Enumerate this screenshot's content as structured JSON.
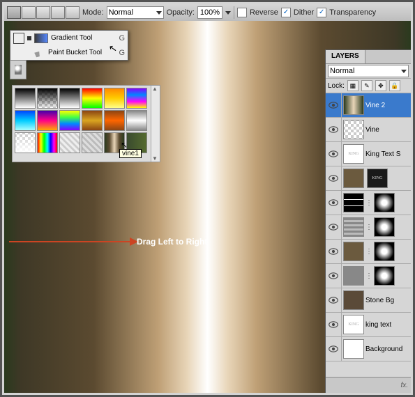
{
  "optbar": {
    "mode_label": "Mode:",
    "mode_value": "Normal",
    "opacity_label": "Opacity:",
    "opacity_value": "100%",
    "reverse_label": "Reverse",
    "dither_label": "Dither",
    "transparency_label": "Transparency",
    "reverse_checked": false,
    "dither_checked": true,
    "transparency_checked": true
  },
  "flyout": {
    "items": [
      {
        "label": "Gradient Tool",
        "shortcut": "G"
      },
      {
        "label": "Paint Bucket Tool",
        "shortcut": "G"
      }
    ]
  },
  "picker": {
    "tooltip": "vine1"
  },
  "annotation": {
    "text": "Drag Left to Right"
  },
  "layers_panel": {
    "tab": "LAYERS",
    "blend_mode": "Normal",
    "lock_label": "Lock:",
    "rows": [
      {
        "name": "Vine 2",
        "thumb": "v2",
        "selected": true
      },
      {
        "name": "Vine",
        "thumb": "checker"
      },
      {
        "name": "King Text S",
        "thumb": "king"
      },
      {
        "name": "",
        "thumb": "tex",
        "thumb2": "kingb"
      },
      {
        "name": "",
        "thumb": "bars",
        "thumb2": "rad",
        "link": true
      },
      {
        "name": "",
        "thumb": "hbars",
        "thumb2": "rad",
        "link": true
      },
      {
        "name": "",
        "thumb": "tex",
        "thumb2": "rad",
        "link": true
      },
      {
        "name": "",
        "thumb": "noise",
        "thumb2": "rad",
        "link": true
      },
      {
        "name": "Stone Bg",
        "thumb": "stone"
      },
      {
        "name": "king text",
        "thumb": "king"
      },
      {
        "name": "Background",
        "thumb": "white"
      }
    ],
    "bottom_fx": "fx."
  }
}
